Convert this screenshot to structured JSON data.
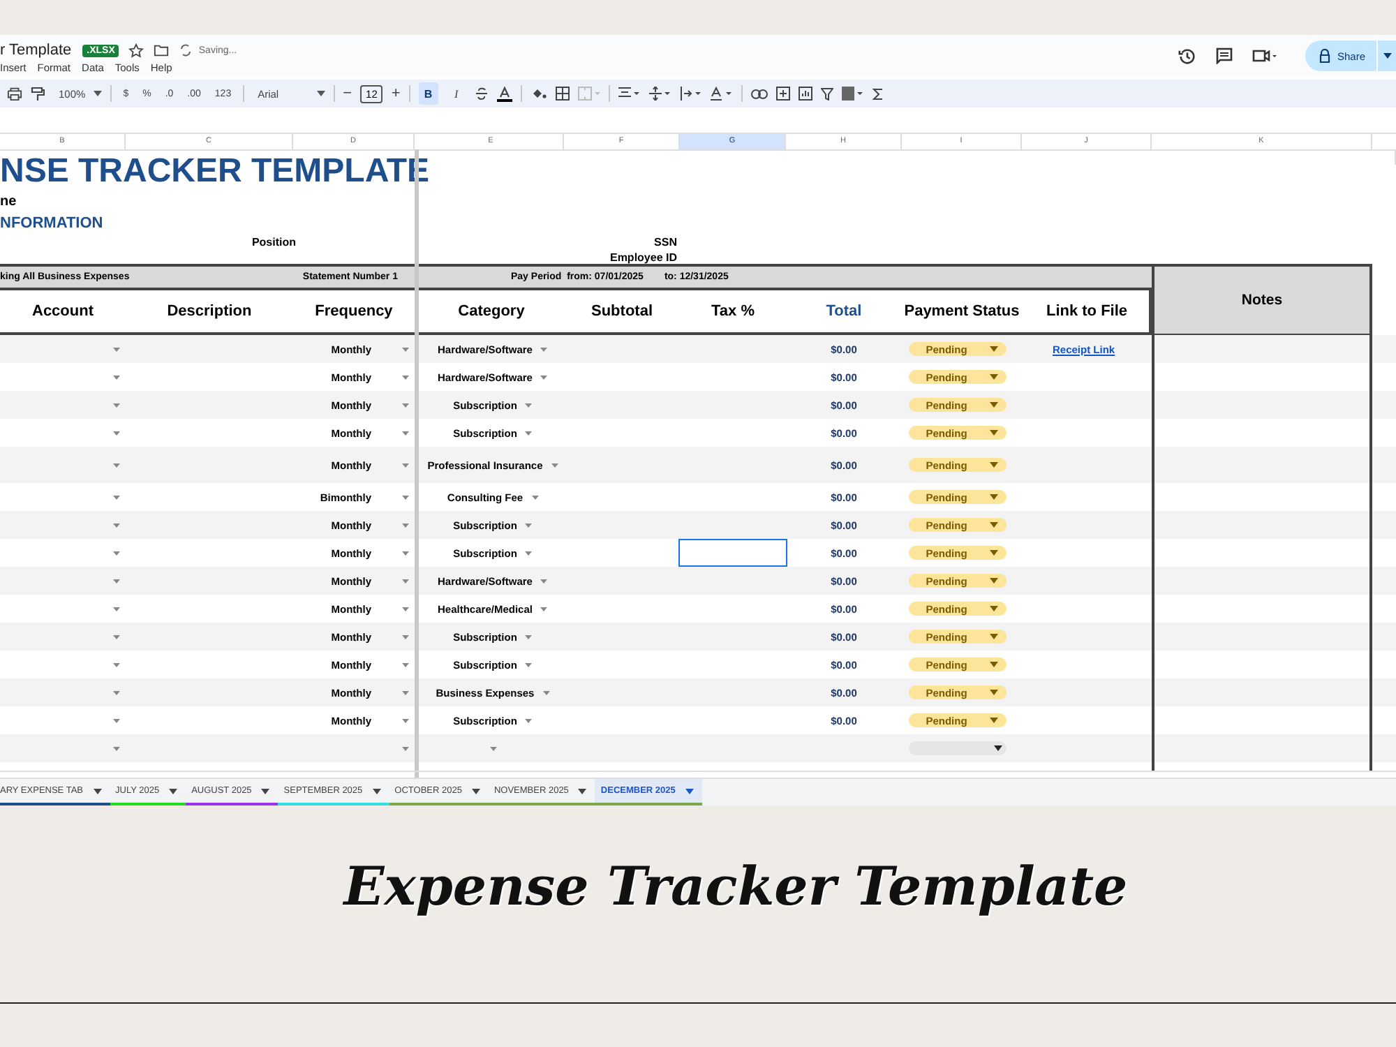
{
  "doc": {
    "title": "r Template",
    "badge": ".XLSX",
    "status": "Saving..."
  },
  "menu": [
    "Insert",
    "Format",
    "Data",
    "Tools",
    "Help"
  ],
  "toolbar": {
    "zoom": "100%",
    "number_formats": [
      "$",
      "%",
      ".0",
      ".00",
      "123"
    ],
    "font": "Arial",
    "decrease": "−",
    "font_size": "12",
    "increase": "+",
    "styles": [
      {
        "label": "B",
        "selected": true
      },
      {
        "label": "I",
        "selected": false
      }
    ]
  },
  "share": {
    "label": "Share"
  },
  "column_headers": [
    {
      "label": "B",
      "selected": false
    },
    {
      "label": "C",
      "selected": false
    },
    {
      "label": "D",
      "selected": false
    },
    {
      "label": "E",
      "selected": false
    },
    {
      "label": "F",
      "selected": false
    },
    {
      "label": "G",
      "selected": true
    },
    {
      "label": "H",
      "selected": false
    },
    {
      "label": "I",
      "selected": false
    },
    {
      "label": "J",
      "selected": false
    },
    {
      "label": "K",
      "selected": false
    }
  ],
  "sheet": {
    "title": "NSE TRACKER TEMPLATE",
    "name_label": "ne",
    "section": "NFORMATION",
    "position_label": "Position",
    "ssn_label": "SSN",
    "employee_id_label": "Employee ID",
    "band": {
      "purpose": "king All Business Expenses",
      "statement": "Statement Number 1",
      "pay_period": "Pay Period  from: 07/01/2025",
      "to": "to: 12/31/2025"
    },
    "headers": [
      {
        "label": "Account",
        "accent": false
      },
      {
        "label": "Description",
        "accent": false
      },
      {
        "label": "Frequency",
        "accent": false
      },
      {
        "label": "Category",
        "accent": false
      },
      {
        "label": "Subtotal",
        "accent": false
      },
      {
        "label": "Tax %",
        "accent": false
      },
      {
        "label": "Total",
        "accent": true
      },
      {
        "label": "Payment Status",
        "accent": false
      },
      {
        "label": "Link to File",
        "accent": false
      }
    ],
    "notes": "Notes"
  },
  "rows": [
    {
      "frequency": "Monthly",
      "category": "Hardware/Software",
      "total": "$0.00",
      "status": "Pending",
      "link": "Receipt Link",
      "tax_selected": false
    },
    {
      "frequency": "Monthly",
      "category": "Hardware/Software",
      "total": "$0.00",
      "status": "Pending",
      "tax_selected": false
    },
    {
      "frequency": "Monthly",
      "category": "Subscription",
      "total": "$0.00",
      "status": "Pending",
      "tax_selected": false
    },
    {
      "frequency": "Monthly",
      "category": "Subscription",
      "total": "$0.00",
      "status": "Pending",
      "tax_selected": false
    },
    {
      "frequency": "Monthly",
      "category": "Professional Insurance",
      "total": "$0.00",
      "status": "Pending",
      "tax_selected": false
    },
    {
      "frequency": "Bimonthly",
      "category": "Consulting Fee",
      "total": "$0.00",
      "status": "Pending",
      "tax_selected": false
    },
    {
      "frequency": "Monthly",
      "category": "Subscription",
      "total": "$0.00",
      "status": "Pending",
      "tax_selected": false
    },
    {
      "frequency": "Monthly",
      "category": "Subscription",
      "total": "$0.00",
      "status": "Pending",
      "tax_selected": true
    },
    {
      "frequency": "Monthly",
      "category": "Hardware/Software",
      "total": "$0.00",
      "status": "Pending",
      "tax_selected": false
    },
    {
      "frequency": "Monthly",
      "category": "Healthcare/Medical",
      "total": "$0.00",
      "status": "Pending",
      "tax_selected": false
    },
    {
      "frequency": "Monthly",
      "category": "Subscription",
      "total": "$0.00",
      "status": "Pending",
      "tax_selected": false
    },
    {
      "frequency": "Monthly",
      "category": "Subscription",
      "total": "$0.00",
      "status": "Pending",
      "tax_selected": false
    },
    {
      "frequency": "Monthly",
      "category": "Business Expenses",
      "total": "$0.00",
      "status": "Pending",
      "tax_selected": false
    },
    {
      "frequency": "Monthly",
      "category": "Subscription",
      "total": "$0.00",
      "status": "Pending",
      "tax_selected": false
    },
    {
      "tax_selected": false
    }
  ],
  "tabs": [
    {
      "label": "ARY EXPENSE TAB",
      "color": "#1f4e8c",
      "selected": false
    },
    {
      "label": "JULY 2025",
      "color": "#22dd22",
      "selected": false
    },
    {
      "label": "AUGUST 2025",
      "color": "#9933ee",
      "selected": false
    },
    {
      "label": "SEPTEMBER 2025",
      "color": "#33dddd",
      "selected": false
    },
    {
      "label": "OCTOBER 2025",
      "color": "#7aa84a",
      "selected": false
    },
    {
      "label": "NOVEMBER 2025",
      "color": "#7aa84a",
      "selected": false
    },
    {
      "label": "DECEMBER 2025",
      "color": "#7aa84a",
      "selected": true
    }
  ],
  "caption": "Expense Tracker Template"
}
